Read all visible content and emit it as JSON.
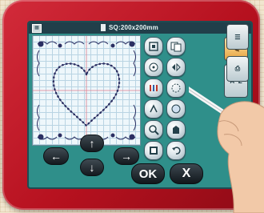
{
  "status_bar": {
    "hoop_size": "SQ:200x200mm"
  },
  "side_panel": {
    "az_label": "A~Z"
  },
  "buttons": {
    "ok_label": "OK",
    "cancel_label": "X"
  },
  "colors": {
    "bezel": "#c8182a",
    "screen": "#2f8f8a",
    "button_dark": "#1a2228"
  }
}
